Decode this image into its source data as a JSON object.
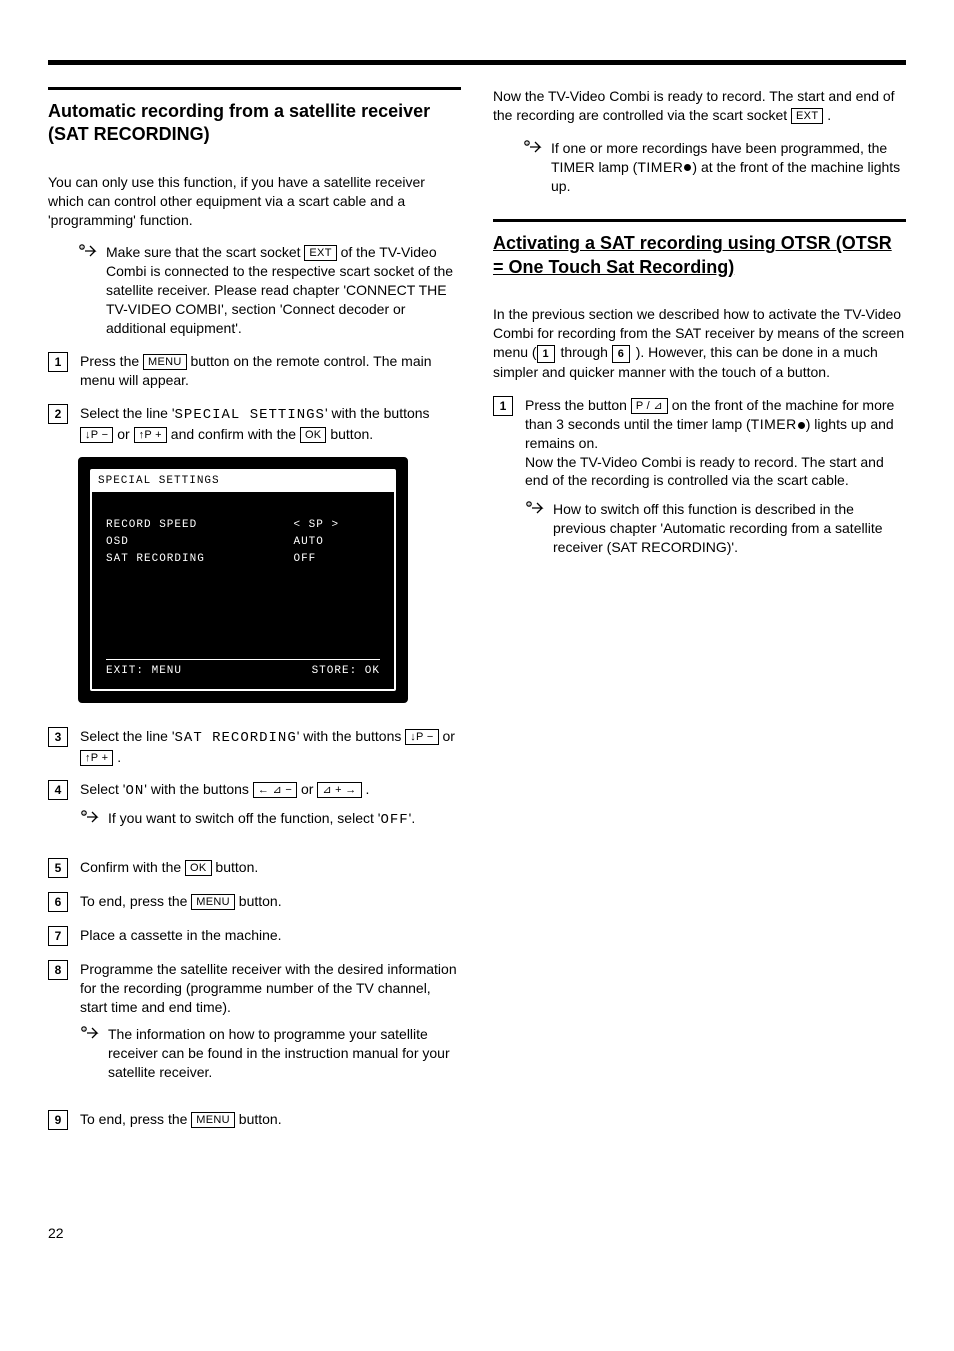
{
  "left": {
    "heading": "Automatic recording from a satellite receiver (SAT RECORDING)",
    "intro": "You can only use this function, if you have a satellite receiver which can control other equipment via a scart cable and a 'programming' function.",
    "note1a": "Make sure that the scart socket ",
    "note1b": " of the TV-Video Combi is connected to the respective scart socket of the satellite receiver. Please read chapter 'CONNECT THE TV-VIDEO COMBI', section 'Connect decoder or additional equipment'.",
    "step1a": "Press the ",
    "step1b": " button on the remote control. The main menu will appear.",
    "step2a": "Select the line '",
    "step2b": "' with the buttons ",
    "step2c": " or ",
    "step2d": " and confirm with the ",
    "step2e": " button.",
    "specialSettings": "SPECIAL SETTINGS",
    "step3a": "Select the line '",
    "step3b": "' with the buttons ",
    "step3c": " or ",
    "step3d": " .",
    "satRecording": "SAT RECORDING",
    "step4a": "Select '",
    "step4on": "ON",
    "step4b": "' with the buttons ",
    "step4c": " or ",
    "step4d": " .",
    "note4a": "If you want to switch off the function, select '",
    "note4off": "OFF",
    "note4b": "'.",
    "step5a": "Confirm with the ",
    "step5b": " button.",
    "step6a": "To end, press the ",
    "step6b": " button.",
    "step7": "Place a cassette in the machine.",
    "step8": "Programme the satellite receiver with the desired information for the recording (programme number of the TV channel, start time and end time).",
    "note8": "The information on how to programme your satellite receiver can be found in the instruction manual for your satellite receiver.",
    "step9a": "To end, press the ",
    "step9b": " button.",
    "keys": {
      "ext": "EXT",
      "menu": "MENU",
      "ok": "OK",
      "pDown": "↓P −",
      "pUp": "↑P +",
      "left": "← ⊿ −",
      "right": "⊿ + →"
    },
    "osd": {
      "title": "SPECIAL SETTINGS",
      "rows": [
        {
          "label": "RECORD SPEED",
          "value": "< SP   >"
        },
        {
          "label": "OSD",
          "value": "  AUTO"
        },
        {
          "label": "SAT RECORDING",
          "value": "  OFF"
        }
      ],
      "footerL": "EXIT: MENU",
      "footerR": "STORE: OK"
    }
  },
  "right": {
    "p1a": "Now the TV-Video Combi is ready to record. The start and end of the recording are controlled via the scart socket ",
    "p1b": " .",
    "note1a": "If one or more recordings have been programmed, the TIMER lamp (",
    "timerLabel": "TIMER",
    "note1b": ") at the front of the machine lights up.",
    "heading": "Activating a SAT recording using OTSR (OTSR = One Touch Sat Recording)",
    "p2a": "In the previous section we described how to activate the TV-Video Combi for recording from the SAT receiver by means of the screen menu (",
    "p2mid": " through ",
    "p2b": " ). However, this can be done in a much simpler and quicker manner with the touch of a button.",
    "step1a": "Press the button ",
    "step1b": " on the front of the machine for more than 3 seconds until the timer lamp (",
    "step1c": ") lights up and remains on.",
    "step1d": "Now the TV-Video Combi is ready to record. The start and end of the recording is controlled via the scart cable.",
    "note2": "How to switch off this function is described in the previous chapter 'Automatic recording from a satellite receiver (SAT RECORDING)'.",
    "keys": {
      "ext": "EXT",
      "prec": "P / ⊿",
      "one": "1",
      "six": "6"
    }
  },
  "pageNumber": "22"
}
